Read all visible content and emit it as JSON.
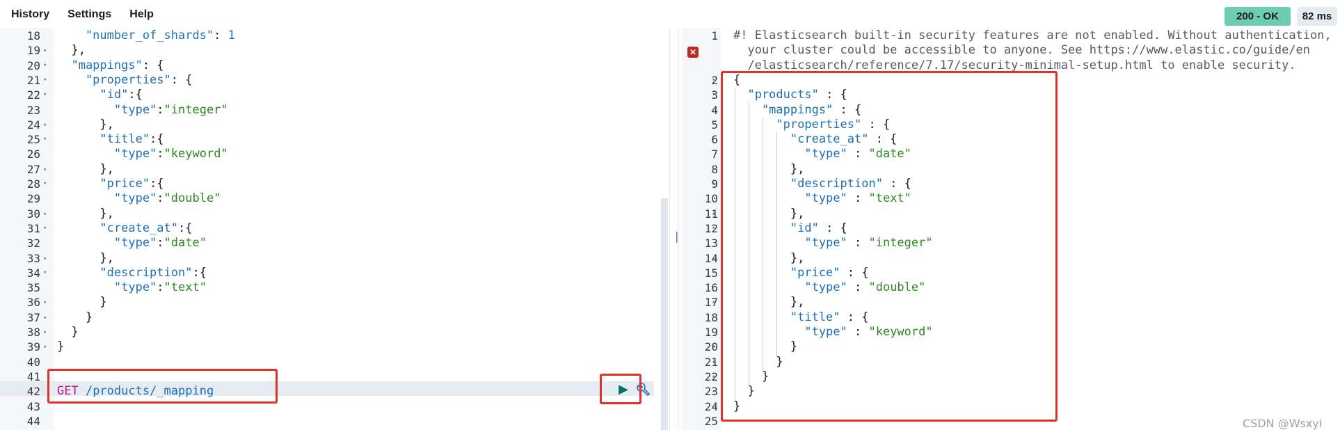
{
  "menu": {
    "history": "History",
    "settings": "Settings",
    "help": "Help"
  },
  "status": {
    "code": "200 - OK",
    "time": "82 ms"
  },
  "left_editor": {
    "lines": [
      {
        "n": "18",
        "fold": "",
        "html": "<span class=\"tok-key\">    \"number_of_shards\"</span><span class=\"tok-punc\">: </span><span class=\"tok-num\">1</span>"
      },
      {
        "n": "19",
        "fold": "▴",
        "html": "<span class=\"tok-punc\">  },</span>"
      },
      {
        "n": "20",
        "fold": "▾",
        "html": "<span class=\"tok-key\">  \"mappings\"</span><span class=\"tok-punc\">: {</span>"
      },
      {
        "n": "21",
        "fold": "▾",
        "html": "<span class=\"tok-key\">    \"properties\"</span><span class=\"tok-punc\">: {</span>"
      },
      {
        "n": "22",
        "fold": "▾",
        "html": "<span class=\"tok-key\">      \"id\"</span><span class=\"tok-punc\">:{</span>"
      },
      {
        "n": "23",
        "fold": "",
        "html": "<span class=\"tok-key\">        \"type\"</span><span class=\"tok-punc\">:</span><span class=\"tok-str\">\"integer\"</span>"
      },
      {
        "n": "24",
        "fold": "▴",
        "html": "<span class=\"tok-punc\">      },</span>"
      },
      {
        "n": "25",
        "fold": "▾",
        "html": "<span class=\"tok-key\">      \"title\"</span><span class=\"tok-punc\">:{</span>"
      },
      {
        "n": "26",
        "fold": "",
        "html": "<span class=\"tok-key\">        \"type\"</span><span class=\"tok-punc\">:</span><span class=\"tok-str\">\"keyword\"</span>"
      },
      {
        "n": "27",
        "fold": "▴",
        "html": "<span class=\"tok-punc\">      },</span>"
      },
      {
        "n": "28",
        "fold": "▾",
        "html": "<span class=\"tok-key\">      \"price\"</span><span class=\"tok-punc\">:{</span>"
      },
      {
        "n": "29",
        "fold": "",
        "html": "<span class=\"tok-key\">        \"type\"</span><span class=\"tok-punc\">:</span><span class=\"tok-str\">\"double\"</span>"
      },
      {
        "n": "30",
        "fold": "▴",
        "html": "<span class=\"tok-punc\">      },</span>"
      },
      {
        "n": "31",
        "fold": "▾",
        "html": "<span class=\"tok-key\">      \"create_at\"</span><span class=\"tok-punc\">:{</span>"
      },
      {
        "n": "32",
        "fold": "",
        "html": "<span class=\"tok-key\">        \"type\"</span><span class=\"tok-punc\">:</span><span class=\"tok-str\">\"date\"</span>"
      },
      {
        "n": "33",
        "fold": "▴",
        "html": "<span class=\"tok-punc\">      },</span>"
      },
      {
        "n": "34",
        "fold": "▾",
        "html": "<span class=\"tok-key\">      \"description\"</span><span class=\"tok-punc\">:{</span>"
      },
      {
        "n": "35",
        "fold": "",
        "html": "<span class=\"tok-key\">        \"type\"</span><span class=\"tok-punc\">:</span><span class=\"tok-str\">\"text\"</span>"
      },
      {
        "n": "36",
        "fold": "▴",
        "html": "<span class=\"tok-punc\">      }</span>"
      },
      {
        "n": "37",
        "fold": "▴",
        "html": "<span class=\"tok-punc\">    }</span>"
      },
      {
        "n": "38",
        "fold": "▴",
        "html": "<span class=\"tok-punc\">  }</span>"
      },
      {
        "n": "39",
        "fold": "▴",
        "html": "<span class=\"tok-punc\">}</span>"
      },
      {
        "n": "40",
        "fold": "",
        "html": ""
      },
      {
        "n": "41",
        "fold": "",
        "html": ""
      },
      {
        "n": "42",
        "fold": "",
        "html": "<span class=\"tok-method\">GET</span><span class=\"tok-path\"> /products/_mapping</span>"
      },
      {
        "n": "43",
        "fold": "",
        "html": ""
      },
      {
        "n": "44",
        "fold": "",
        "html": ""
      }
    ]
  },
  "right_editor": {
    "lines": [
      {
        "n": "1",
        "fold": "",
        "html": "<span class=\"tok-comment\">#! Elasticsearch built-in security features are not enabled. Without authentication,</span>"
      },
      {
        "n": "",
        "fold": "",
        "html": "<span class=\"tok-comment\">  your cluster could be accessible to anyone. See https://www.elastic.co/guide/en</span>"
      },
      {
        "n": "",
        "fold": "",
        "html": "<span class=\"tok-comment\">  /elasticsearch/reference/7.17/security-minimal-setup.html to enable security.</span>"
      },
      {
        "n": "2",
        "fold": "▾",
        "html": "<span class=\"tok-punc\">{</span>"
      },
      {
        "n": "3",
        "fold": "▾",
        "html": "<span class=\"tok-key\">  \"products\"</span><span class=\"tok-punc\"> : {</span>"
      },
      {
        "n": "4",
        "fold": "▾",
        "html": "<span class=\"tok-key\">    \"mappings\"</span><span class=\"tok-punc\"> : {</span>"
      },
      {
        "n": "5",
        "fold": "▾",
        "html": "<span class=\"tok-key\">      \"properties\"</span><span class=\"tok-punc\"> : {</span>"
      },
      {
        "n": "6",
        "fold": "▾",
        "html": "<span class=\"tok-key\">        \"create_at\"</span><span class=\"tok-punc\"> : {</span>"
      },
      {
        "n": "7",
        "fold": "",
        "html": "<span class=\"tok-key\">          \"type\"</span><span class=\"tok-punc\"> : </span><span class=\"tok-str\">\"date\"</span>"
      },
      {
        "n": "8",
        "fold": "▴",
        "html": "<span class=\"tok-punc\">        },</span>"
      },
      {
        "n": "9",
        "fold": "▾",
        "html": "<span class=\"tok-key\">        \"description\"</span><span class=\"tok-punc\"> : {</span>"
      },
      {
        "n": "10",
        "fold": "",
        "html": "<span class=\"tok-key\">          \"type\"</span><span class=\"tok-punc\"> : </span><span class=\"tok-str\">\"text\"</span>"
      },
      {
        "n": "11",
        "fold": "▴",
        "html": "<span class=\"tok-punc\">        },</span>"
      },
      {
        "n": "12",
        "fold": "▾",
        "html": "<span class=\"tok-key\">        \"id\"</span><span class=\"tok-punc\"> : {</span>"
      },
      {
        "n": "13",
        "fold": "",
        "html": "<span class=\"tok-key\">          \"type\"</span><span class=\"tok-punc\"> : </span><span class=\"tok-str\">\"integer\"</span>"
      },
      {
        "n": "14",
        "fold": "▴",
        "html": "<span class=\"tok-punc\">        },</span>"
      },
      {
        "n": "15",
        "fold": "▾",
        "html": "<span class=\"tok-key\">        \"price\"</span><span class=\"tok-punc\"> : {</span>"
      },
      {
        "n": "16",
        "fold": "",
        "html": "<span class=\"tok-key\">          \"type\"</span><span class=\"tok-punc\"> : </span><span class=\"tok-str\">\"double\"</span>"
      },
      {
        "n": "17",
        "fold": "▴",
        "html": "<span class=\"tok-punc\">        },</span>"
      },
      {
        "n": "18",
        "fold": "▾",
        "html": "<span class=\"tok-key\">        \"title\"</span><span class=\"tok-punc\"> : {</span>"
      },
      {
        "n": "19",
        "fold": "",
        "html": "<span class=\"tok-key\">          \"type\"</span><span class=\"tok-punc\"> : </span><span class=\"tok-str\">\"keyword\"</span>"
      },
      {
        "n": "20",
        "fold": "▴",
        "html": "<span class=\"tok-punc\">        }</span>"
      },
      {
        "n": "21",
        "fold": "▴",
        "html": "<span class=\"tok-punc\">      }</span>"
      },
      {
        "n": "22",
        "fold": "▴",
        "html": "<span class=\"tok-punc\">    }</span>"
      },
      {
        "n": "23",
        "fold": "▴",
        "html": "<span class=\"tok-punc\">  }</span>"
      },
      {
        "n": "24",
        "fold": "▴",
        "html": "<span class=\"tok-punc\">}</span>"
      },
      {
        "n": "25",
        "fold": "",
        "html": ""
      }
    ]
  },
  "watermark": "CSDN @Wsxyi"
}
